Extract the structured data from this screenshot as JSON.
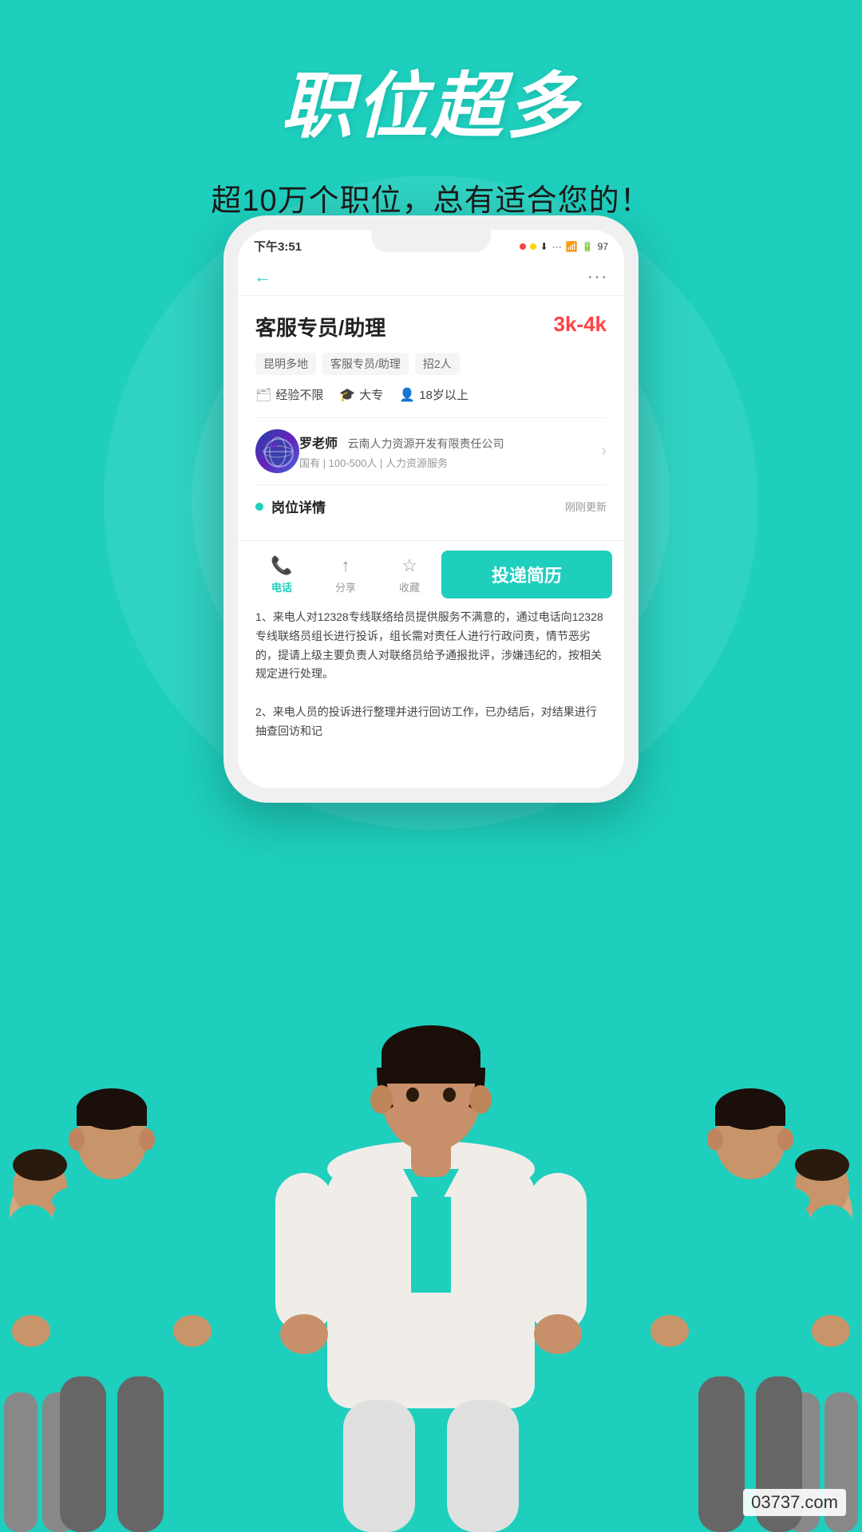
{
  "app": {
    "title": "职位超多",
    "subtitle": "超10万个职位，总有适合您的！"
  },
  "status_bar": {
    "time": "下午3:51",
    "battery": "97"
  },
  "job": {
    "title": "客服专员/助理",
    "salary": "3k-4k",
    "tags": [
      "昆明多地",
      "客服专员/助理",
      "招2人"
    ],
    "requirements": {
      "experience": "经验不限",
      "education": "大专",
      "age": "18岁以上"
    },
    "recruiter": "罗老师",
    "company_name": "云南人力资源开发有限责任公司",
    "company_type": "国有",
    "company_size": "100-500人",
    "company_industry": "人力资源服务",
    "section_title": "岗位详情",
    "update_time": "刚刚更新",
    "description": "1、来电人对12328专线联络员提供服务不满意的，通过电话向12328专线联络员组长进行投诉，组长需对责任人进行行政问责，情节恶劣的，提请上级主要负责人对联络员给予通报批评，涉嫌违纪的，按相关规定进行处理。\n2、来电人员的投诉进行整理并进行回访工作，已办结后，对结果进行抽查回访和记录。"
  },
  "actions": {
    "phone_label": "电话",
    "share_label": "分享",
    "collect_label": "收藏",
    "apply_label": "投递简历"
  },
  "watermark": {
    "text": "03737.com"
  }
}
